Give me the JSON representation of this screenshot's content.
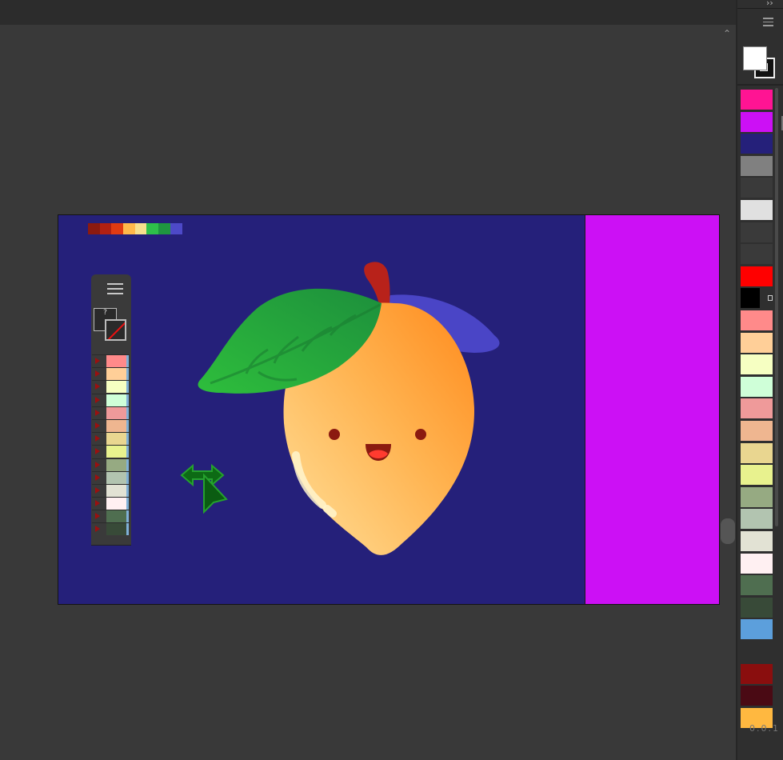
{
  "toolbar": {
    "collapse_glyph": "››",
    "scroll_up_glyph": "⌃"
  },
  "document": {
    "background_color": "#25207a",
    "right_area_color": "#cc10f5",
    "palette_strip": [
      "#8b1a10",
      "#b22012",
      "#e03a12",
      "#ffb84a",
      "#f6e08c",
      "#2ec04a",
      "#1f9640",
      "#4d49c8"
    ]
  },
  "mini_panel": {
    "fill_label": "?",
    "stroke_label": "?",
    "swatches": [
      "#ff8a8a",
      "#ffcf98",
      "#f6ffc2",
      "#cfffd8",
      "#ef9a9a",
      "#efb690",
      "#e9d690",
      "#e8f28e",
      "#96aa82",
      "#b2c4b0",
      "#e2e2d4",
      "#fff0f2",
      "#4f6e50",
      "#384a38"
    ]
  },
  "right_panel": {
    "fill_color": "#ffffff",
    "stroke_color": "#111111",
    "swatches": [
      {
        "color": "#ff1493"
      },
      {
        "color": "#cc10f5"
      },
      {
        "color": "#25207a"
      },
      {
        "color": "#808080"
      },
      {
        "color": "#3a3a3a"
      },
      {
        "color": "#e0e0e0"
      },
      {
        "color": "#3a3a3a"
      },
      {
        "color": "#3a3a3a"
      },
      {
        "color": "#ff0000"
      },
      {
        "color": "#000000"
      },
      {
        "color": "#ff8a8a"
      },
      {
        "color": "#ffcf98"
      },
      {
        "color": "#f6ffc2"
      },
      {
        "color": "#cfffd8"
      },
      {
        "color": "#ef9a9a"
      },
      {
        "color": "#efb690"
      },
      {
        "color": "#e9d690"
      },
      {
        "color": "#e8f28e"
      },
      {
        "color": "#96aa82"
      },
      {
        "color": "#b2c4b0"
      },
      {
        "color": "#e2e2d4"
      },
      {
        "color": "#fff0f2"
      },
      {
        "color": "#4f6e50"
      },
      {
        "color": "#384a38"
      },
      {
        "color": "#5c9fdc"
      },
      {
        "color": "#2f2f2f"
      },
      {
        "color": "#8a0e0e"
      },
      {
        "color": "#4a0a14"
      },
      {
        "color": "#ffb840"
      }
    ],
    "version": "0.0.1"
  }
}
